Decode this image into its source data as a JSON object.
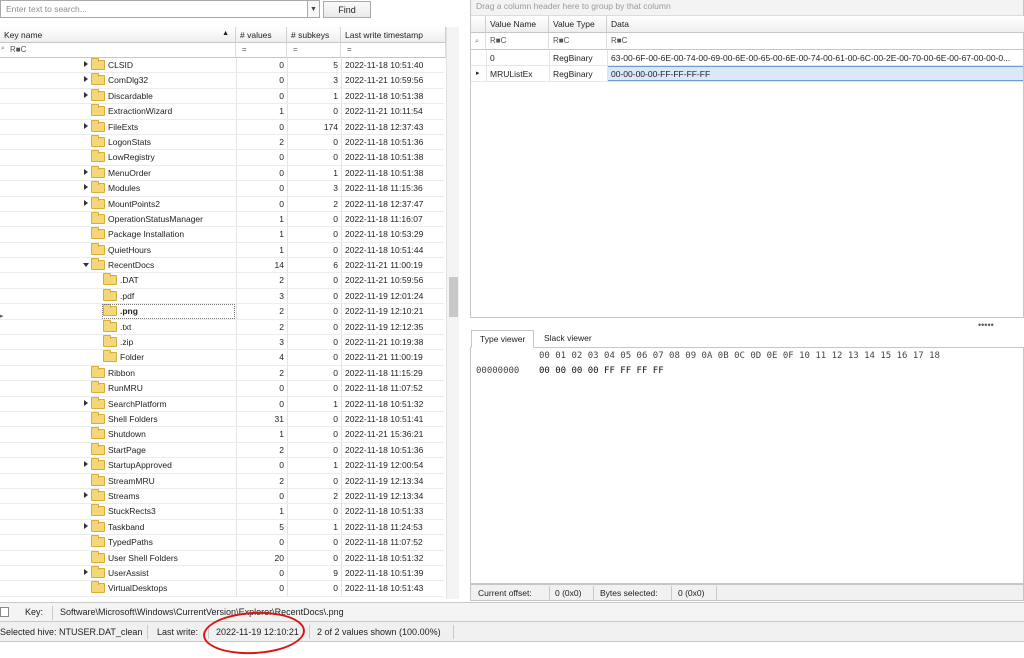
{
  "search": {
    "placeholder": "Enter text to search...",
    "find_label": "Find"
  },
  "left_grid": {
    "columns": [
      "Key name",
      "# values",
      "# subkeys",
      "Last write timestamp"
    ],
    "filter_symbols": [
      "R■C",
      "=",
      "=",
      "="
    ],
    "rows": [
      {
        "name": "CLSID",
        "values": "0",
        "subkeys": "5",
        "ts": "2022-11-18 10:51:40",
        "level": 0,
        "expander": "right"
      },
      {
        "name": "ComDlg32",
        "values": "0",
        "subkeys": "3",
        "ts": "2022-11-21 10:59:56",
        "level": 0,
        "expander": "right"
      },
      {
        "name": "Discardable",
        "values": "0",
        "subkeys": "1",
        "ts": "2022-11-18 10:51:38",
        "level": 0,
        "expander": "right"
      },
      {
        "name": "ExtractionWizard",
        "values": "1",
        "subkeys": "0",
        "ts": "2022-11-21 10:11:54",
        "level": 0,
        "expander": ""
      },
      {
        "name": "FileExts",
        "values": "0",
        "subkeys": "174",
        "ts": "2022-11-18 12:37:43",
        "level": 0,
        "expander": "right"
      },
      {
        "name": "LogonStats",
        "values": "2",
        "subkeys": "0",
        "ts": "2022-11-18 10:51:36",
        "level": 0,
        "expander": ""
      },
      {
        "name": "LowRegistry",
        "values": "0",
        "subkeys": "0",
        "ts": "2022-11-18 10:51:38",
        "level": 0,
        "expander": ""
      },
      {
        "name": "MenuOrder",
        "values": "0",
        "subkeys": "1",
        "ts": "2022-11-18 10:51:38",
        "level": 0,
        "expander": "right"
      },
      {
        "name": "Modules",
        "values": "0",
        "subkeys": "3",
        "ts": "2022-11-18 11:15:36",
        "level": 0,
        "expander": "right"
      },
      {
        "name": "MountPoints2",
        "values": "0",
        "subkeys": "2",
        "ts": "2022-11-18 12:37:47",
        "level": 0,
        "expander": "right"
      },
      {
        "name": "OperationStatusManager",
        "values": "1",
        "subkeys": "0",
        "ts": "2022-11-18 11:16:07",
        "level": 0,
        "expander": ""
      },
      {
        "name": "Package Installation",
        "values": "1",
        "subkeys": "0",
        "ts": "2022-11-18 10:53:29",
        "level": 0,
        "expander": ""
      },
      {
        "name": "QuietHours",
        "values": "1",
        "subkeys": "0",
        "ts": "2022-11-18 10:51:44",
        "level": 0,
        "expander": ""
      },
      {
        "name": "RecentDocs",
        "values": "14",
        "subkeys": "6",
        "ts": "2022-11-21 11:00:19",
        "level": 0,
        "expander": "down"
      },
      {
        "name": ".DAT",
        "values": "2",
        "subkeys": "0",
        "ts": "2022-11-21 10:59:56",
        "level": 1,
        "expander": ""
      },
      {
        "name": ".pdf",
        "values": "3",
        "subkeys": "0",
        "ts": "2022-11-19 12:01:24",
        "level": 1,
        "expander": ""
      },
      {
        "name": ".png",
        "values": "2",
        "subkeys": "0",
        "ts": "2022-11-19 12:10:21",
        "level": 1,
        "expander": "",
        "selected": true
      },
      {
        "name": ".txt",
        "values": "2",
        "subkeys": "0",
        "ts": "2022-11-19 12:12:35",
        "level": 1,
        "expander": ""
      },
      {
        "name": ".zip",
        "values": "3",
        "subkeys": "0",
        "ts": "2022-11-21 10:19:38",
        "level": 1,
        "expander": ""
      },
      {
        "name": "Folder",
        "values": "4",
        "subkeys": "0",
        "ts": "2022-11-21 11:00:19",
        "level": 1,
        "expander": ""
      },
      {
        "name": "Ribbon",
        "values": "2",
        "subkeys": "0",
        "ts": "2022-11-18 11:15:29",
        "level": 0,
        "expander": ""
      },
      {
        "name": "RunMRU",
        "values": "0",
        "subkeys": "0",
        "ts": "2022-11-18 11:07:52",
        "level": 0,
        "expander": ""
      },
      {
        "name": "SearchPlatform",
        "values": "0",
        "subkeys": "1",
        "ts": "2022-11-18 10:51:32",
        "level": 0,
        "expander": "right"
      },
      {
        "name": "Shell Folders",
        "values": "31",
        "subkeys": "0",
        "ts": "2022-11-18 10:51:41",
        "level": 0,
        "expander": ""
      },
      {
        "name": "Shutdown",
        "values": "1",
        "subkeys": "0",
        "ts": "2022-11-21 15:36:21",
        "level": 0,
        "expander": ""
      },
      {
        "name": "StartPage",
        "values": "2",
        "subkeys": "0",
        "ts": "2022-11-18 10:51:36",
        "level": 0,
        "expander": ""
      },
      {
        "name": "StartupApproved",
        "values": "0",
        "subkeys": "1",
        "ts": "2022-11-19 12:00:54",
        "level": 0,
        "expander": "right"
      },
      {
        "name": "StreamMRU",
        "values": "2",
        "subkeys": "0",
        "ts": "2022-11-19 12:13:34",
        "level": 0,
        "expander": ""
      },
      {
        "name": "Streams",
        "values": "0",
        "subkeys": "2",
        "ts": "2022-11-19 12:13:34",
        "level": 0,
        "expander": "right"
      },
      {
        "name": "StuckRects3",
        "values": "1",
        "subkeys": "0",
        "ts": "2022-11-18 10:51:33",
        "level": 0,
        "expander": ""
      },
      {
        "name": "Taskband",
        "values": "5",
        "subkeys": "1",
        "ts": "2022-11-18 11:24:53",
        "level": 0,
        "expander": "right"
      },
      {
        "name": "TypedPaths",
        "values": "0",
        "subkeys": "0",
        "ts": "2022-11-18 11:07:52",
        "level": 0,
        "expander": ""
      },
      {
        "name": "User Shell Folders",
        "values": "20",
        "subkeys": "0",
        "ts": "2022-11-18 10:51:32",
        "level": 0,
        "expander": ""
      },
      {
        "name": "UserAssist",
        "values": "0",
        "subkeys": "9",
        "ts": "2022-11-18 10:51:39",
        "level": 0,
        "expander": "right"
      },
      {
        "name": "VirtualDesktops",
        "values": "0",
        "subkeys": "0",
        "ts": "2022-11-18 10:51:43",
        "level": 0,
        "expander": ""
      }
    ]
  },
  "right_grid": {
    "group_hint": "Drag a column header here to group by that column",
    "columns": [
      "Value Name",
      "Value Type",
      "Data"
    ],
    "filter_symbols": [
      "R■C",
      "R■C",
      "R■C"
    ],
    "rows": [
      {
        "name": "0",
        "type": "RegBinary",
        "data": "63-00-6F-00-6E-00-74-00-69-00-6E-00-65-00-6E-00-74-00-61-00-6C-00-2E-00-70-00-6E-00-67-00-00-0..."
      },
      {
        "name": "MRUListEx",
        "type": "RegBinary",
        "data": "00-00-00-00-FF-FF-FF-FF",
        "selected": true
      }
    ]
  },
  "hex_viewer": {
    "tabs": [
      "Type viewer",
      "Slack viewer"
    ],
    "header": "00 01 02 03 04 05 06 07 08 09 0A 0B 0C 0D 0E 0F 10 11 12 13 14 15 16 17 18",
    "offset": "00000000",
    "bytes": "00 00 00 00 FF FF FF FF",
    "status": {
      "offset_label": "Current offset:",
      "offset_value": "0 (0x0)",
      "bytes_label": "Bytes selected:",
      "bytes_value": "0 (0x0)"
    }
  },
  "keybar": {
    "label": "Key:",
    "path": "Software\\Microsoft\\Windows\\CurrentVersion\\Explorer\\RecentDocs\\.png"
  },
  "statusbar": {
    "hive": "Selected hive: NTUSER.DAT_clean",
    "lastwrite_label": "Last write:",
    "lastwrite_value": "2022-11-19 12:10:21",
    "values_shown": "2 of 2 values shown (100.00%)"
  },
  "colors": {
    "annotation": "#d81818",
    "folder": "#f5d77a",
    "selection": "#dbe8f7"
  }
}
